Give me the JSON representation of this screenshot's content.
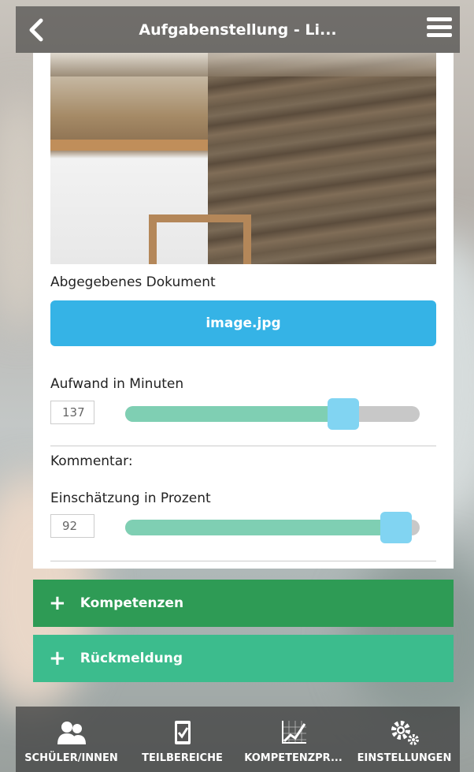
{
  "header": {
    "title": "Aufgabenstellung - Li..."
  },
  "submission": {
    "document_label": "Abgegebenes Dokument",
    "file_name": "image.jpg"
  },
  "effort": {
    "label": "Aufwand in Minuten",
    "value": "137",
    "slider_fraction": 0.74
  },
  "comment": {
    "label": "Kommentar:"
  },
  "rating": {
    "label": "Einschätzung in Prozent",
    "value": "92",
    "slider_fraction": 0.92
  },
  "sections": [
    {
      "label": "Kompetenzen",
      "color": "#2e9b55"
    },
    {
      "label": "Rückmeldung",
      "color": "#3cbc8d"
    }
  ],
  "tabs": [
    {
      "label": "SCHÜLER/INNEN",
      "icon": "users-icon"
    },
    {
      "label": "TEILBEREICHE",
      "icon": "checklist-icon"
    },
    {
      "label": "KOMPETENZPR...",
      "icon": "chart-icon"
    },
    {
      "label": "EINSTELLUNGEN",
      "icon": "gears-icon"
    }
  ],
  "colors": {
    "header_bg": "rgba(40,40,40,0.55)",
    "file_button": "#35b3e6",
    "slider_fill": "#7fcfb3",
    "slider_thumb": "#81d4f2"
  }
}
